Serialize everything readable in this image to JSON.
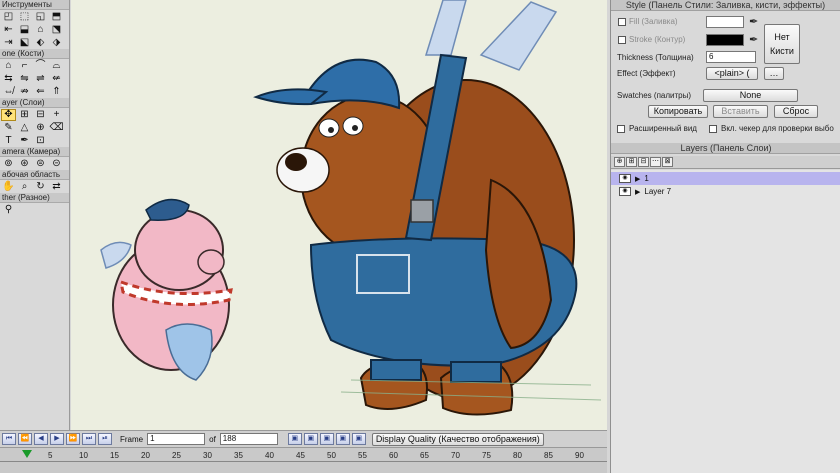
{
  "tools_panel": {
    "sections": [
      {
        "title": "Инструменты",
        "rows": [
          [
            "◰",
            "⬚",
            "◱",
            "⬒"
          ],
          [
            "⇤",
            "⬓",
            "⌂",
            "⬔"
          ],
          [
            "⇥",
            "⬕",
            "⬖",
            "⬗"
          ]
        ]
      },
      {
        "title": "one (Кости)",
        "rows": [
          [
            "⌂",
            "⌐",
            "⌒",
            "⌓"
          ],
          [
            "⇆",
            "⇋",
            "⇌",
            "⇍"
          ],
          [
            "⇎",
            "⇏",
            "⇐",
            "⇑"
          ]
        ]
      },
      {
        "title": "ayer (Слои)",
        "rows": [
          [
            "✥",
            "⊞",
            "⊟",
            "+"
          ],
          [
            "✎",
            "△",
            "⊕",
            "⌫"
          ],
          [
            "T",
            "✒",
            "⊡",
            ""
          ]
        ]
      },
      {
        "title": "amera (Камера)",
        "rows": [
          [
            "⊚",
            "⊛",
            "⊜",
            "⊝"
          ]
        ]
      },
      {
        "title": "абочая область",
        "rows": [
          [
            "✋",
            "⌕",
            "↻",
            "⇄"
          ]
        ]
      },
      {
        "title": "ther (Разное)",
        "rows": [
          [
            "⚲",
            "",
            "",
            ""
          ]
        ]
      }
    ]
  },
  "style_panel": {
    "title": "Style (Панель Стили: Заливка, кисти, эффекты)",
    "fill_label": "Fill (Заливка)",
    "stroke_label": "Stroke (Контур)",
    "no_brush_label": "Нет Кисти",
    "thickness_label": "Thickness (Толщина)",
    "thickness_value": "6",
    "effect_label": "Effect (Эффект)",
    "effect_value": "<plain> (",
    "swatches_label": "Swatches (палитры)",
    "swatches_value": "None",
    "copy_button": "Копировать",
    "paste_button": "Вставить",
    "reset_button": "Сброс",
    "advanced_label": "Расширенный вид",
    "checker_label": "Вкл. чекер для проверки выбо",
    "fill_color": "#ffffff",
    "stroke_color": "#000000"
  },
  "layers_panel": {
    "title": "Layers (Панель Слои)",
    "toolbar_icons": [
      "⊕",
      "⊞",
      "⊟",
      "⋯",
      "⊠"
    ],
    "layers": [
      {
        "name": "1",
        "selected": true
      },
      {
        "name": "Layer 7",
        "selected": false
      }
    ]
  },
  "playback": {
    "frame_label": "Frame",
    "frame_value": "1",
    "of_label": "of",
    "total_frames": "188",
    "display_quality": "Display Quality (Качество отображения)"
  },
  "timeline": {
    "ticks": [
      "5",
      "10",
      "15",
      "20",
      "25",
      "30",
      "35",
      "40",
      "45",
      "50",
      "55",
      "60",
      "65",
      "70",
      "75",
      "80",
      "85",
      "90"
    ]
  },
  "icons": {
    "play_buttons": [
      "⏮",
      "⏪",
      "◀",
      "▶",
      "⏩",
      "⏭",
      "⏯"
    ]
  }
}
